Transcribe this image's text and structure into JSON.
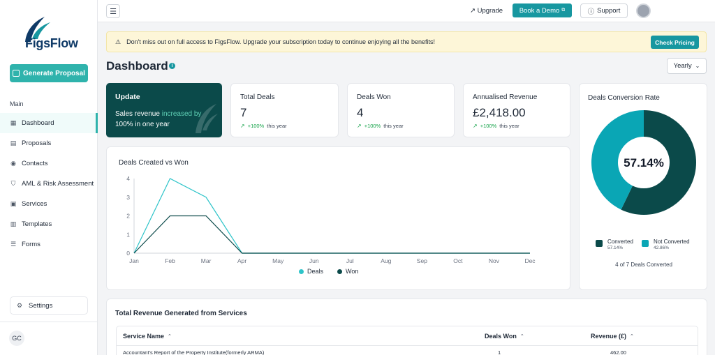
{
  "sidebar": {
    "logo_text": "FigsFlow",
    "generate_label": "Generate Proposal",
    "section_main": "Main",
    "items": [
      {
        "label": "Dashboard",
        "icon": "grid-icon"
      },
      {
        "label": "Proposals",
        "icon": "document-icon"
      },
      {
        "label": "Contacts",
        "icon": "contact-icon"
      },
      {
        "label": "AML & Risk Assessment",
        "icon": "shield-icon"
      },
      {
        "label": "Services",
        "icon": "clipboard-icon"
      },
      {
        "label": "Templates",
        "icon": "template-icon"
      },
      {
        "label": "Forms",
        "icon": "list-icon"
      }
    ],
    "settings_label": "Settings",
    "avatar_initials": "GC"
  },
  "topbar": {
    "upgrade_label": "Upgrade",
    "book_demo_label": "Book a Demo",
    "support_label": "Support"
  },
  "banner": {
    "text": "Don't miss out on full access to FigsFlow. Upgrade your subscription today to continue enjoying all the benefits!",
    "button": "Check Pricing"
  },
  "page": {
    "title": "Dashboard",
    "period": "Yearly"
  },
  "update_card": {
    "title": "Update",
    "pre": "Sales revenue ",
    "highlight": "increased by",
    "post": "100% in one year"
  },
  "stats": [
    {
      "label": "Total Deals",
      "value": "7",
      "pct": "+100%",
      "note": "this year"
    },
    {
      "label": "Deals Won",
      "value": "4",
      "pct": "+100%",
      "note": "this year"
    },
    {
      "label": "Annualised Revenue",
      "value": "£2,418.00",
      "pct": "+100%",
      "note": "this year"
    }
  ],
  "colors": {
    "accent": "#1797a0",
    "deals": "#2ec4c9",
    "won": "#0b4a4a"
  },
  "chart_data": [
    {
      "type": "line",
      "title": "Deals Created vs Won",
      "categories": [
        "Jan",
        "Feb",
        "Mar",
        "Apr",
        "May",
        "Jun",
        "Jul",
        "Aug",
        "Sep",
        "Oct",
        "Nov",
        "Dec"
      ],
      "series": [
        {
          "name": "Deals",
          "values": [
            0,
            4,
            3,
            0,
            0,
            0,
            0,
            0,
            0,
            0,
            0,
            0
          ]
        },
        {
          "name": "Won",
          "values": [
            0,
            2,
            2,
            0,
            0,
            0,
            0,
            0,
            0,
            0,
            0,
            0
          ]
        }
      ],
      "ylim": [
        0,
        4
      ],
      "yticks": [
        "0",
        "1",
        "2",
        "3",
        "4"
      ],
      "legend": "bottom"
    },
    {
      "type": "pie",
      "title": "Deals Conversion Rate",
      "center_label": "57.14%",
      "slices": [
        {
          "name": "Converted",
          "value": 57.14,
          "label": "57.14%"
        },
        {
          "name": "Not Converted",
          "value": 42.86,
          "label": "42.86%"
        }
      ],
      "footer": "4 of 7 Deals Converted",
      "legend": "bottom"
    }
  ],
  "revenue": {
    "title": "Total Revenue Generated from Services",
    "columns": [
      "Service Name",
      "Deals Won",
      "Revenue (£)"
    ],
    "rows": [
      {
        "service": "Accountant's Report of the Property Institute(formerly ARMA)",
        "deals": "1",
        "revenue": "462.00"
      }
    ]
  }
}
